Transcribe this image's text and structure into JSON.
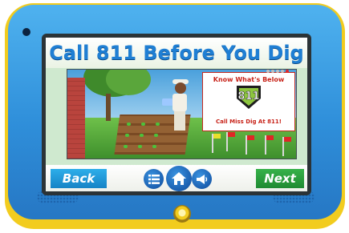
{
  "title": "Call 811 Before You Dig",
  "scene": {
    "info_card": {
      "headline": "Know What's Below",
      "logo_number": "811",
      "tagline": "Call Miss Dig At 811!"
    }
  },
  "nav": {
    "back_label": "Back",
    "next_label": "Next",
    "icons": [
      "menu-icon",
      "home-icon",
      "speaker-icon"
    ]
  },
  "colors": {
    "shell_blue": "#2f8fda",
    "rim_yellow": "#f2cc1e",
    "title_blue": "#1f7fd4",
    "back_blue": "#1683c6",
    "next_green": "#1f8a32",
    "warning_red": "#c8241a"
  }
}
